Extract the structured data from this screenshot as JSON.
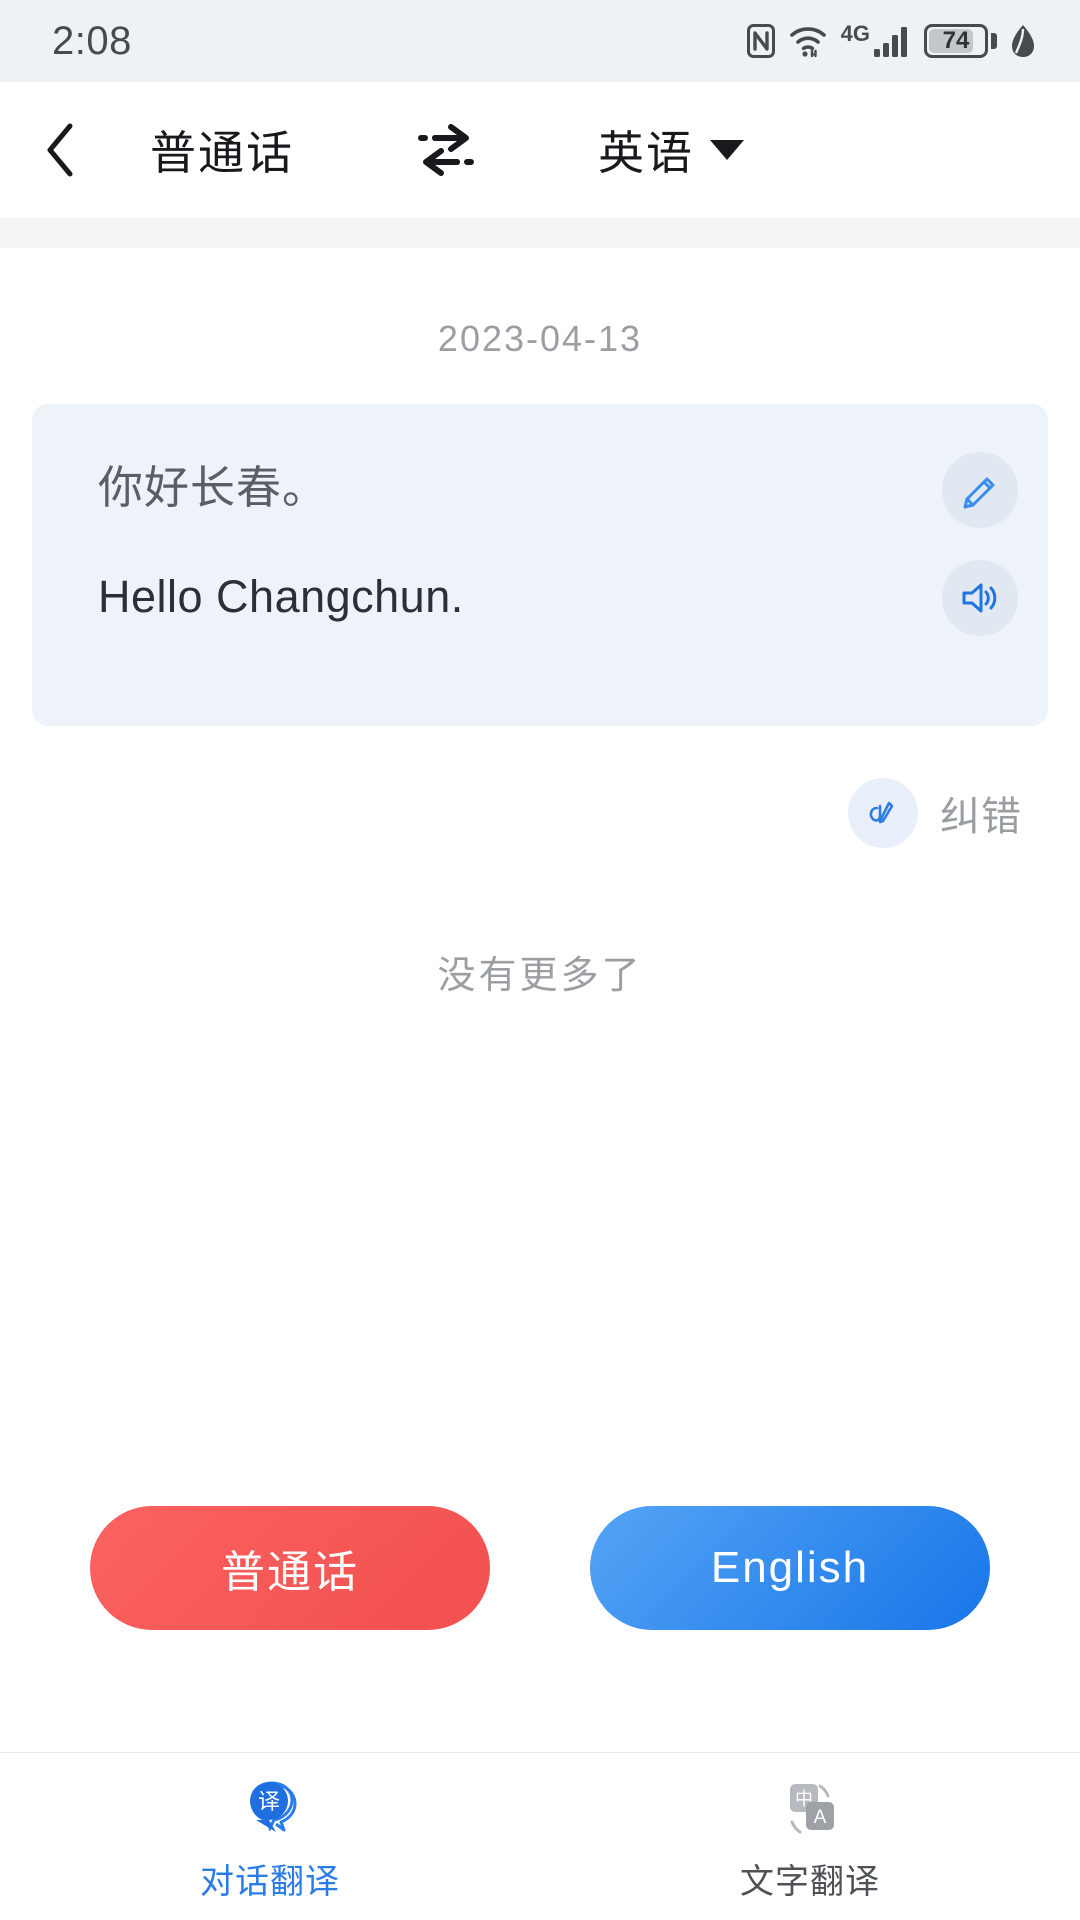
{
  "status_bar": {
    "time": "2:08",
    "battery_level": "74",
    "network_type": "4G",
    "icons": [
      "nfc-icon",
      "wifi-icon",
      "network-4g-label",
      "signal-bars-icon",
      "battery-icon",
      "leaf-icon"
    ]
  },
  "header": {
    "back_icon": "chevron-left-icon",
    "source_language": "普通话",
    "swap_icon": "swap-arrows-icon",
    "target_language": "英语",
    "dropdown_icon": "chevron-down-icon"
  },
  "conversation": {
    "date": "2023-04-13",
    "entry": {
      "source_text": "你好长春。",
      "target_text": "Hello Changchun.",
      "edit_icon": "pencil-icon",
      "speak_icon": "speaker-icon"
    },
    "correction": {
      "icon": "correction-pen-icon",
      "label": "纠错"
    },
    "end_of_list": "没有更多了"
  },
  "mic_buttons": {
    "left_label": "普通话",
    "right_label": "English",
    "left_color": "#f1504f",
    "right_color": "#1876e8"
  },
  "tab_bar": {
    "tabs": [
      {
        "label": "对话翻译",
        "icon": "speech-bubble-translate-icon",
        "active": true
      },
      {
        "label": "文字翻译",
        "icon": "text-translate-icon",
        "active": false
      }
    ],
    "active_color": "#2a7ce8",
    "inactive_color": "#4e5155"
  }
}
